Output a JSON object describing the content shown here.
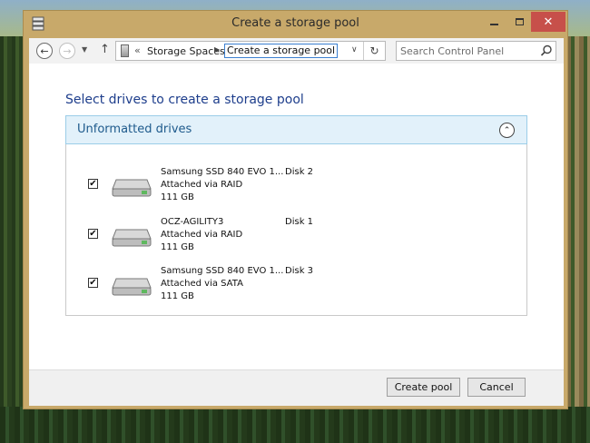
{
  "window": {
    "title": "Create a storage pool"
  },
  "navigation": {
    "back_glyph": "←",
    "forward_glyph": "→",
    "recent_glyph": "▼",
    "up_glyph": "↑",
    "address_overflow": "«",
    "breadcrumb": "Storage Spaces",
    "breadcrumb_arrow": "▶",
    "current_location": "Create a storage pool",
    "dropdown_glyph": "∨",
    "refresh_glyph": "↻",
    "search_placeholder": "Search Control Panel"
  },
  "main": {
    "heading": "Select drives to create a storage pool",
    "group": {
      "title": "Unformatted drives",
      "collapse_glyph": "⌃",
      "drives": [
        {
          "name": "Samsung SSD 840 EVO 1...",
          "connection": "Attached via RAID",
          "size": "111 GB",
          "disk": "Disk 2",
          "checked": true
        },
        {
          "name": "OCZ-AGILITY3",
          "connection": "Attached via RAID",
          "size": "111 GB",
          "disk": "Disk 1",
          "checked": true
        },
        {
          "name": "Samsung SSD 840 EVO 1...",
          "connection": "Attached via SATA",
          "size": "111 GB",
          "disk": "Disk 3",
          "checked": true
        }
      ]
    }
  },
  "footer": {
    "create_label": "Create pool",
    "cancel_label": "Cancel"
  },
  "colors": {
    "accent_title_bar": "#c8a96a",
    "heading_blue": "#1e3e8c",
    "group_header_bg": "#e2f1fa",
    "close_button": "#c7504a"
  }
}
